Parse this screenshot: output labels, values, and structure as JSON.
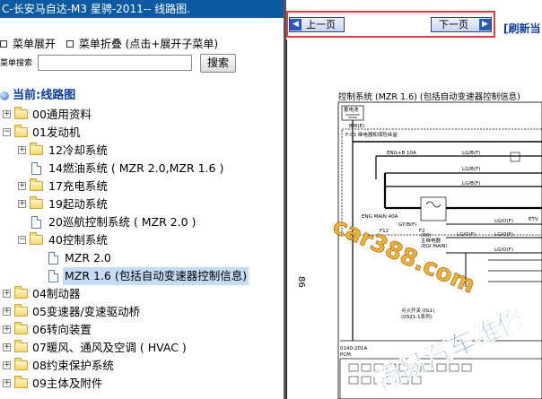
{
  "window": {
    "title": "C-长安马自达-M3 星骋-2011-- 线路图."
  },
  "toolbar": {
    "expand_label": "菜单展开",
    "collapse_label": "菜单折叠 (点击+展开子菜单)"
  },
  "search": {
    "label": "菜单搜索",
    "value": "",
    "button": "搜索"
  },
  "tree": {
    "root": "当前:线路图",
    "items": [
      {
        "label": "00通用资料"
      },
      {
        "label": "01发动机"
      },
      {
        "label": "12冷却系统"
      },
      {
        "label": "14燃油系统 ( MZR 2.0,MZR 1.6 )"
      },
      {
        "label": "17充电系统"
      },
      {
        "label": "19起动系统"
      },
      {
        "label": "20巡航控制系统 ( MZR 2.0 )"
      },
      {
        "label": "40控制系统"
      },
      {
        "label": "MZR 2.0"
      },
      {
        "label": "MZR 1.6 (包括自动变速器控制信息)"
      },
      {
        "label": "04制动器"
      },
      {
        "label": "05变速器/变速驱动桥"
      },
      {
        "label": "06转向装置"
      },
      {
        "label": "07暖风、通风及空调 ( HVAC )"
      },
      {
        "label": "08约束保护系统"
      },
      {
        "label": "09主体及附件"
      }
    ]
  },
  "nav": {
    "prev_label": "上一页",
    "next_label": "下一页",
    "refresh_label": "[刷新当"
  },
  "diagram": {
    "title": "控制系统 (MZR 1.6) (包括自动变速器控制信息)",
    "page_number": "86",
    "labels": {
      "battery": "蓄电池",
      "b_rue": "B/R(E)",
      "f01": "F-01 继电器和保险丝盒",
      "eng_b": "ENG+B 10A",
      "lg_b1": "LG/B(F)",
      "lg_b2": "LG/B(F)",
      "lg_b3": "LG/B(F)",
      "eng_main": "ENG MAIN 40A",
      "gy_b": "GY/B(F)",
      "f12": "F12",
      "f2": "F2",
      "r6": "(R6)",
      "main_relay": "主继电器",
      "egi_main": "(EGI MAIN)",
      "lg_o1": "LG/O(F)",
      "lg_o2": "LG/O(F)",
      "lg_o3": "LG/O(F)",
      "lg_o4": "LG/O(F)",
      "etv": "ETV",
      "ignition": "点火开关 (IG1)",
      "ignition_code": "(0921-1系列)",
      "pcm_code": "0140-201A",
      "pcm": "PCM"
    },
    "watermark_1": "car388.com",
    "watermark_2": "畅易汽车维修"
  },
  "colors": {
    "title_bar": "#0b5aa2",
    "highlight": "#e23b3b",
    "watermark": "#f2b233",
    "watermark2": "#2b5fc9"
  }
}
